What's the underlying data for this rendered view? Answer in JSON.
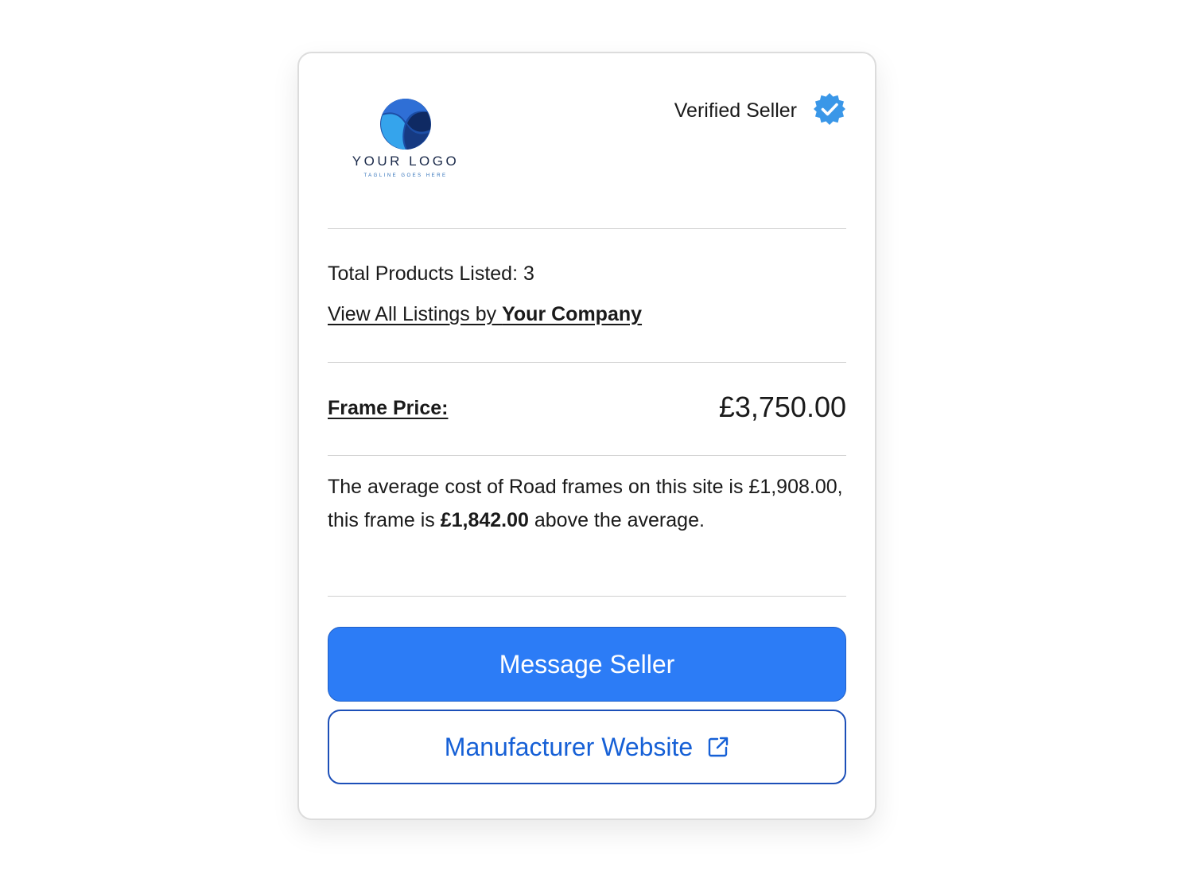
{
  "logo": {
    "name": "YOUR LOGO",
    "tagline": "TAGLINE GOES HERE"
  },
  "seller": {
    "verified_label": "Verified Seller",
    "badge_icon": "verified-check-icon",
    "badge_color": "#3a97e8"
  },
  "listings": {
    "total_label": "Total Products Listed: 3",
    "view_all_prefix": "View All Listings by ",
    "company_name": "Your Company"
  },
  "price": {
    "label": "Frame Price:",
    "value": "£3,750.00"
  },
  "average": {
    "text_before": "The average cost of Road frames on this site is £1,908.00, this frame is ",
    "difference": "£1,842.00",
    "text_after": " above the average."
  },
  "actions": {
    "message_label": "Message Seller",
    "website_label": "Manufacturer Website",
    "website_icon": "external-link-icon",
    "primary_color": "#2c7cf6",
    "secondary_color": "#1660d6"
  }
}
